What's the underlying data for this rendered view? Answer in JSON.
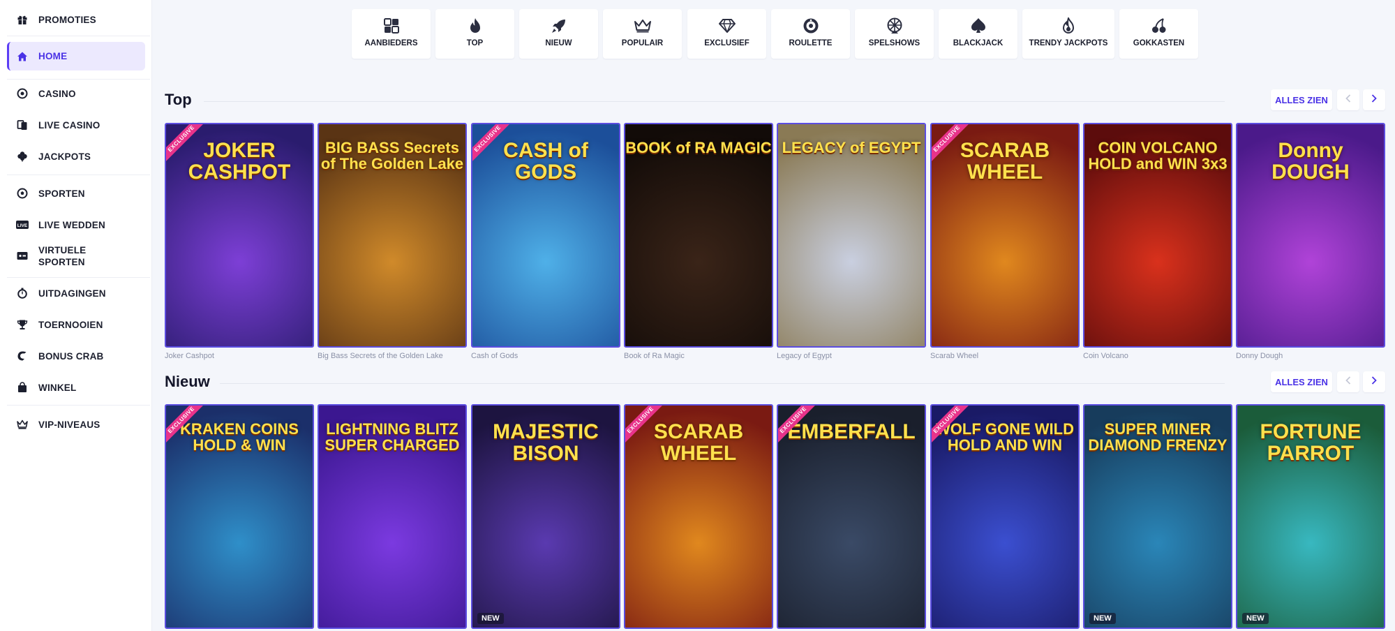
{
  "sidebar": {
    "items": [
      {
        "label": "PROMOTIES",
        "icon": "gift-icon"
      },
      {
        "label": "HOME",
        "icon": "home-icon",
        "active": true
      },
      {
        "label": "CASINO",
        "icon": "casino-chip-icon"
      },
      {
        "label": "LIVE CASINO",
        "icon": "live-cards-icon"
      },
      {
        "label": "JACKPOTS",
        "icon": "clover-icon"
      },
      {
        "label": "SPORTEN",
        "icon": "soccer-ball-icon"
      },
      {
        "label": "LIVE WEDDEN",
        "icon": "live-badge-icon"
      },
      {
        "label": "VIRTUELE SPORTEN",
        "icon": "virtual-screen-icon"
      },
      {
        "label": "UITDAGINGEN",
        "icon": "stopwatch-icon"
      },
      {
        "label": "TOERNOOIEN",
        "icon": "trophy-icon"
      },
      {
        "label": "BONUS CRAB",
        "icon": "crab-icon"
      },
      {
        "label": "WINKEL",
        "icon": "shopping-bag-icon"
      },
      {
        "label": "VIP-NIVEAUS",
        "icon": "crown-icon"
      }
    ]
  },
  "categories": [
    {
      "label": "AANBIEDERS",
      "icon": "providers-grid-icon"
    },
    {
      "label": "TOP",
      "icon": "flame-icon"
    },
    {
      "label": "NIEUW",
      "icon": "rocket-icon"
    },
    {
      "label": "POPULAIR",
      "icon": "crown-icon"
    },
    {
      "label": "EXCLUSIEF",
      "icon": "diamond-icon"
    },
    {
      "label": "ROULETTE",
      "icon": "roulette-icon"
    },
    {
      "label": "SPELSHOWS",
      "icon": "wheel-icon"
    },
    {
      "label": "BLACKJACK",
      "icon": "spade-icon"
    },
    {
      "label": "TRENDY JACKPOTS",
      "icon": "flame-jackpot-icon"
    },
    {
      "label": "GOKKASTEN",
      "icon": "cherries-icon"
    }
  ],
  "sections": [
    {
      "title": "Top",
      "see_all": "ALLES ZIEN",
      "games": [
        {
          "name": "Joker Cashpot",
          "art_title": "JOKER CASHPOT",
          "badge": "EXCLUSIVE",
          "colors": [
            "#7d3fd6",
            "#2a1c6e"
          ]
        },
        {
          "name": "Big Bass Secrets of the Golden Lake",
          "art_title": "BIG BASS Secrets of The Golden Lake",
          "badge": "",
          "colors": [
            "#d08a2a",
            "#5a3414"
          ]
        },
        {
          "name": "Cash of Gods",
          "art_title": "CASH of GODS",
          "badge": "EXCLUSIVE",
          "colors": [
            "#4fb0e8",
            "#1c4f9a"
          ]
        },
        {
          "name": "Book of Ra Magic",
          "art_title": "BOOK of RA MAGIC",
          "badge": "",
          "colors": [
            "#3a2418",
            "#120b08"
          ]
        },
        {
          "name": "Legacy of Egypt",
          "art_title": "LEGACY of EGYPT",
          "badge": "",
          "colors": [
            "#c9cfe0",
            "#8a7a55"
          ]
        },
        {
          "name": "Scarab Wheel",
          "art_title": "SCARAB WHEEL",
          "badge": "EXCLUSIVE",
          "colors": [
            "#e0881e",
            "#7a1a12"
          ]
        },
        {
          "name": "Coin Volcano",
          "art_title": "COIN VOLCANO HOLD and WIN 3x3",
          "badge": "",
          "colors": [
            "#d9311c",
            "#5c0c0c"
          ]
        },
        {
          "name": "Donny Dough",
          "art_title": "Donny DOUGH",
          "badge": "",
          "colors": [
            "#b043d8",
            "#4b1a8a"
          ]
        }
      ]
    },
    {
      "title": "Nieuw",
      "see_all": "ALLES ZIEN",
      "games": [
        {
          "name": "Kraken Coins",
          "art_title": "KRAKEN COINS HOLD & WIN",
          "badge": "EXCLUSIVE",
          "new": "",
          "colors": [
            "#2f8fc9",
            "#1b2f6a"
          ]
        },
        {
          "name": "Lightning Blitz Super Charged",
          "art_title": "LIGHTNING BLITZ SUPER CHARGED",
          "badge": "",
          "new": "",
          "colors": [
            "#7b3ae0",
            "#3b1790"
          ]
        },
        {
          "name": "Majestic Bison",
          "art_title": "MAJESTIC BISON",
          "badge": "",
          "new": "NEW",
          "colors": [
            "#5a3ab0",
            "#1d1440"
          ]
        },
        {
          "name": "Scarab Wheel",
          "art_title": "SCARAB WHEEL",
          "badge": "EXCLUSIVE",
          "new": "",
          "colors": [
            "#e0881e",
            "#7a1a12"
          ]
        },
        {
          "name": "Emberfall",
          "art_title": "EMBERFALL",
          "badge": "EXCLUSIVE",
          "new": "",
          "colors": [
            "#3a4a66",
            "#1a1f2c"
          ]
        },
        {
          "name": "Wolf Gone Wild",
          "art_title": "WOLF GONE WILD HOLD AND WIN",
          "badge": "EXCLUSIVE",
          "new": "",
          "colors": [
            "#3b4fd0",
            "#1a1a66"
          ]
        },
        {
          "name": "Super Miner Diamond Frenzy",
          "art_title": "SUPER MINER DIAMOND FRENZY",
          "badge": "",
          "new": "NEW",
          "colors": [
            "#2a86b8",
            "#173c5c"
          ]
        },
        {
          "name": "Fortune Parrot",
          "art_title": "FORTUNE PARROT",
          "badge": "",
          "new": "NEW",
          "colors": [
            "#38b8c0",
            "#1b5c3a"
          ]
        }
      ]
    }
  ]
}
